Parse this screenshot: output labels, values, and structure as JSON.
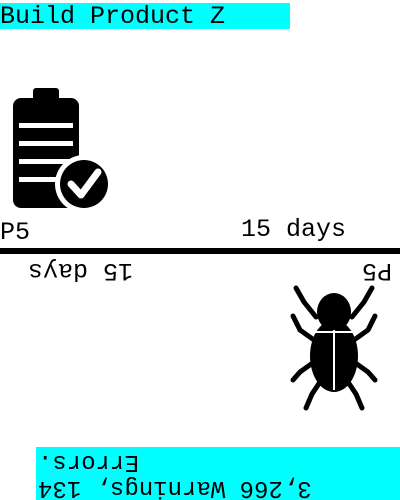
{
  "header": {
    "title": "Build Product Z"
  },
  "left_panel": {
    "priority": "P5",
    "duration": "15 days",
    "icon": "clipboard-check-icon"
  },
  "right_panel": {
    "priority": "P5",
    "duration": "15 days",
    "icon": "bug-icon",
    "status": "3,266 Warnings, 134 Errors."
  },
  "colors": {
    "highlight": "#00ffff",
    "ink": "#000000",
    "background": "#ffffff"
  }
}
